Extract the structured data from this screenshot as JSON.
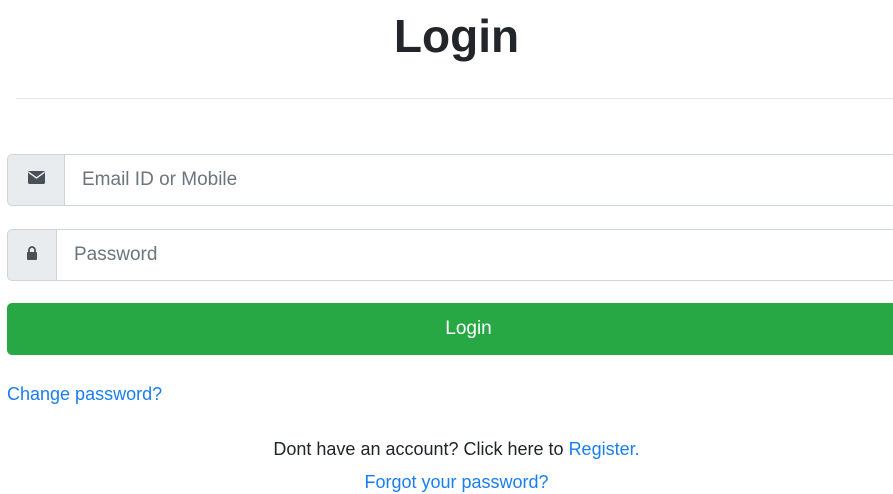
{
  "header": {
    "title": "Login"
  },
  "form": {
    "email": {
      "placeholder": "Email ID or Mobile",
      "icon": "envelope-icon"
    },
    "password": {
      "placeholder": "Password",
      "icon": "lock-icon"
    },
    "submit_label": "Login",
    "submit_color": "#28a745"
  },
  "links": {
    "change_password": "Change password?",
    "register_prompt": "Dont have an account? Click here to ",
    "register_label": "Register.",
    "forgot_password": "Forgot your password?",
    "link_color": "#1a7ef0"
  }
}
